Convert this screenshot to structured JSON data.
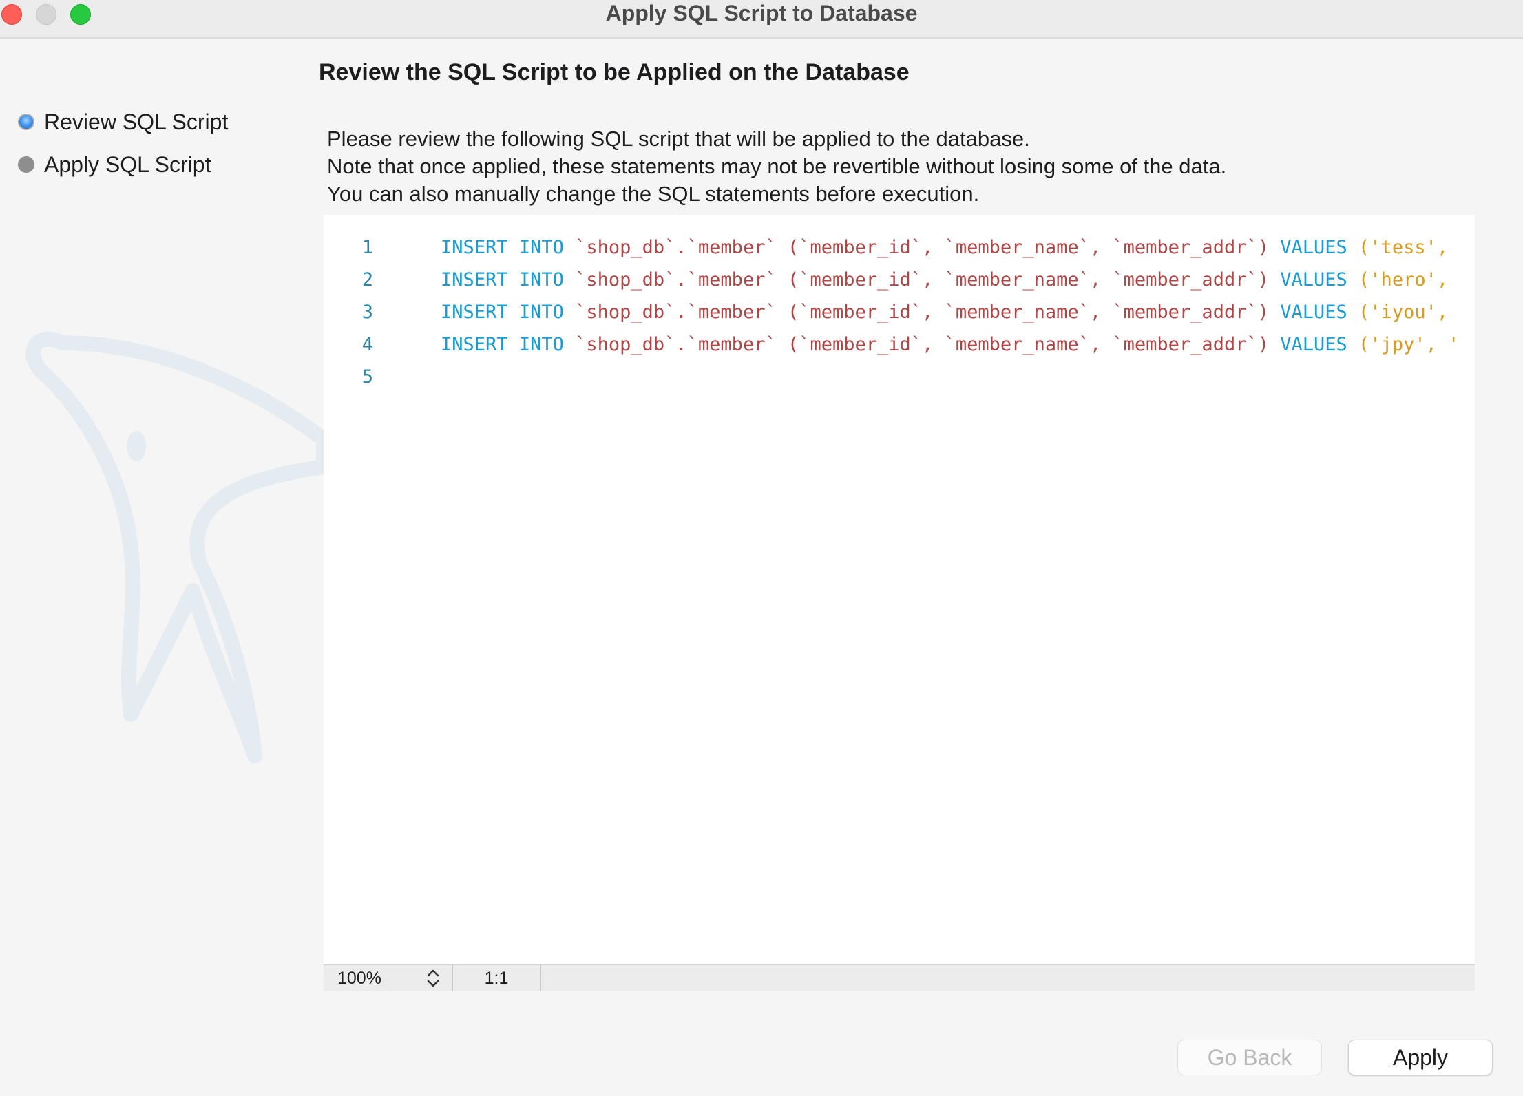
{
  "window": {
    "title": "Apply SQL Script to Database"
  },
  "sidebar": {
    "steps": [
      {
        "label": "Review SQL Script",
        "state": "active"
      },
      {
        "label": "Apply SQL Script",
        "state": "inactive"
      }
    ]
  },
  "main": {
    "heading": "Review the SQL Script to be Applied on the Database",
    "description": [
      "Please review the following SQL script that will be applied to the database.",
      "Note that once applied, these statements may not be revertible without losing some of the data.",
      "You can also manually change the SQL statements before execution."
    ]
  },
  "editor": {
    "lines": [
      {
        "number": "1",
        "table": "`shop_db`.`member`",
        "columns": "(`member_id`, `member_name`, `member_addr`)",
        "value_start": "('tess',"
      },
      {
        "number": "2",
        "table": "`shop_db`.`member`",
        "columns": "(`member_id`, `member_name`, `member_addr`)",
        "value_start": "('hero',"
      },
      {
        "number": "3",
        "table": "`shop_db`.`member`",
        "columns": "(`member_id`, `member_name`, `member_addr`)",
        "value_start": "('iyou',"
      },
      {
        "number": "4",
        "table": "`shop_db`.`member`",
        "columns": "(`member_id`, `member_name`, `member_addr`)",
        "value_start": "('jpy', '"
      },
      {
        "number": "5",
        "table": "",
        "columns": "",
        "value_start": ""
      }
    ],
    "keywords": {
      "insert": "INSERT",
      "into": "INTO",
      "values": "VALUES"
    },
    "status": {
      "zoom": "100%",
      "cursor_position": "1:1"
    }
  },
  "buttons": {
    "go_back": "Go Back",
    "apply": "Apply"
  },
  "colors": {
    "keyword": "#1a9bd1",
    "identifier": "#b04545",
    "string": "#d79b1d",
    "line_number": "#2a86a8"
  }
}
